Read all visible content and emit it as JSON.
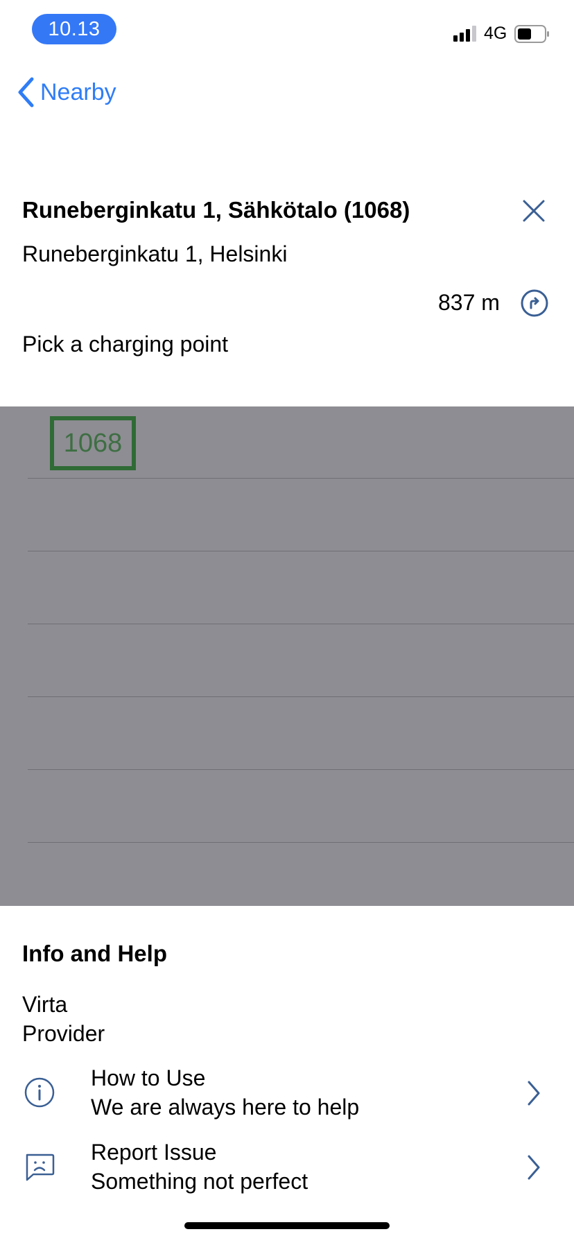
{
  "status_bar": {
    "time": "10.13",
    "network": "4G"
  },
  "nav": {
    "back_label": "Nearby"
  },
  "location": {
    "title": "Runeberginkatu 1, Sähkötalo (1068)",
    "address": "Runeberginkatu 1, Helsinki",
    "distance": "837 m",
    "pick_label": "Pick a charging point"
  },
  "charging_points": {
    "selected_id": "1068"
  },
  "info": {
    "heading": "Info and Help",
    "provider_name": "Virta",
    "provider_label": "Provider",
    "items": [
      {
        "title": "How to Use",
        "subtitle": "We are always here to help",
        "icon": "info-icon"
      },
      {
        "title": "Report Issue",
        "subtitle": "Something not perfect",
        "icon": "sad-chat-icon"
      }
    ]
  },
  "colors": {
    "accent": "#2f7df6",
    "icon_blue": "#3a5f94",
    "time_pill": "#3478f6",
    "overlay": "#8e8d93",
    "selection_border": "#2f6b35"
  }
}
